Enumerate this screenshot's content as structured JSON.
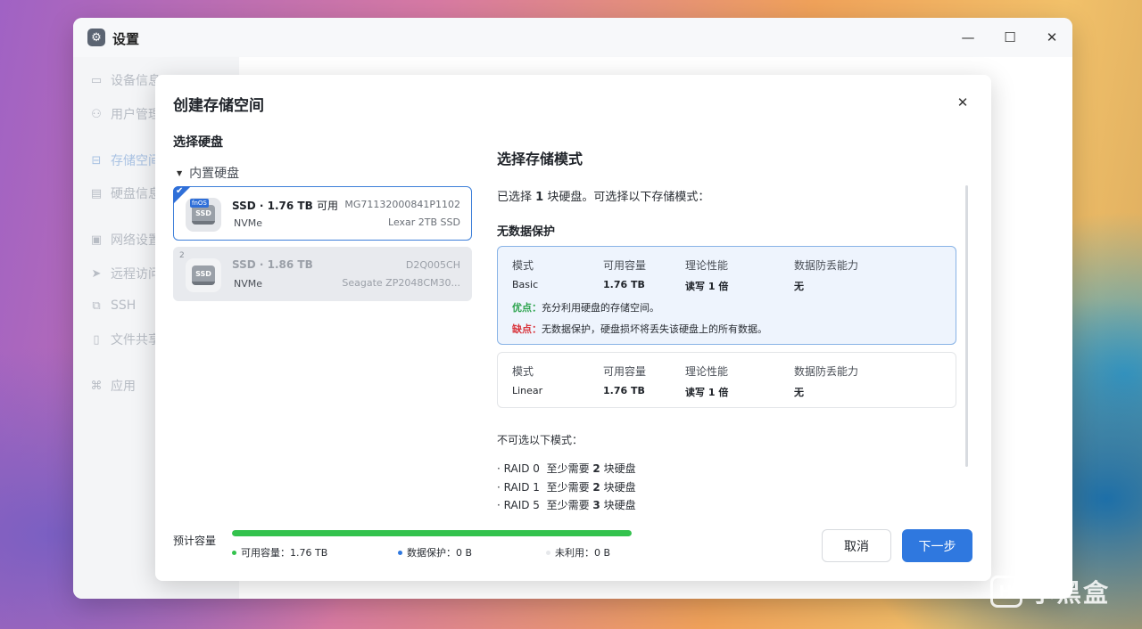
{
  "window": {
    "title": "设置",
    "app_icon": "gear-icon",
    "controls": {
      "minimize": "—",
      "maximize": "☐",
      "close": "✕"
    }
  },
  "sidebar": {
    "items": [
      {
        "label": "设备信息",
        "icon": "▭"
      },
      {
        "label": "用户管理",
        "icon": "⚇"
      },
      {
        "label": "存储空间",
        "icon": "⊟"
      },
      {
        "label": "硬盘信息",
        "icon": "▤"
      },
      {
        "label": "网络设置",
        "icon": "▣"
      },
      {
        "label": "远程访问",
        "icon": "➤"
      },
      {
        "label": "SSH",
        "icon": "⧉"
      },
      {
        "label": "文件共享",
        "icon": "▯"
      },
      {
        "label": "应用",
        "icon": "⌘"
      }
    ]
  },
  "dialog": {
    "title": "创建存储空间",
    "close": "✕",
    "disk_section": "选择硬盘",
    "disk_group": "内置硬盘",
    "disks": [
      {
        "selected": true,
        "badge": "fnOS",
        "icon_text": "SSD",
        "name": "SSD · 1.76 TB",
        "avail": "可用",
        "type": "NVMe",
        "serial": "MG71132000841P1102",
        "model": "Lexar 2TB SSD"
      },
      {
        "selected": false,
        "number": "2",
        "icon_text": "SSD",
        "name": "SSD · 1.86 TB",
        "type": "NVMe",
        "serial": "D2Q005CH",
        "model": "Seagate ZP2048CM30..."
      }
    ],
    "mode_title": "选择存储模式",
    "summary_pre": "已选择",
    "summary_count": "1",
    "summary_post": "块硬盘。可选择以下存储模式：",
    "no_protection": "无数据保护",
    "headers": {
      "mode": "模式",
      "capacity": "可用容量",
      "performance": "理论性能",
      "protection": "数据防丢能力"
    },
    "modes": [
      {
        "name": "Basic",
        "capacity": "1.76 TB",
        "performance": "读写 1 倍",
        "protection": "无",
        "pro_key": "优点：",
        "pro": "充分利用硬盘的存储空间。",
        "con_key": "缺点：",
        "con": "无数据保护，硬盘损坏将丢失该硬盘上的所有数据。"
      },
      {
        "name": "Linear",
        "capacity": "1.76 TB",
        "performance": "读写 1 倍",
        "protection": "无"
      }
    ],
    "unavailable_title": "不可选以下模式：",
    "raids": [
      {
        "name": "· RAID 0",
        "pre": "至少需要",
        "count": "2",
        "post": "块硬盘"
      },
      {
        "name": "· RAID 1",
        "pre": "至少需要",
        "count": "2",
        "post": "块硬盘"
      },
      {
        "name": "· RAID 5",
        "pre": "至少需要",
        "count": "3",
        "post": "块硬盘"
      }
    ],
    "capacity": {
      "label": "预计容量",
      "fill_percent": 100,
      "legend": [
        {
          "text": "可用容量：1.76 TB",
          "color": "#33c24d"
        },
        {
          "text": "数据保护：0 B",
          "color": "#2f78df"
        },
        {
          "text": "未利用：0 B",
          "color": "#e6e8eb"
        }
      ]
    },
    "buttons": {
      "cancel": "取消",
      "next": "下一步"
    }
  },
  "watermark": {
    "text": "小黑盒",
    "icon": "H"
  },
  "colors": {
    "accent": "#2f78df",
    "success": "#33c24d",
    "danger": "#d9363e"
  }
}
